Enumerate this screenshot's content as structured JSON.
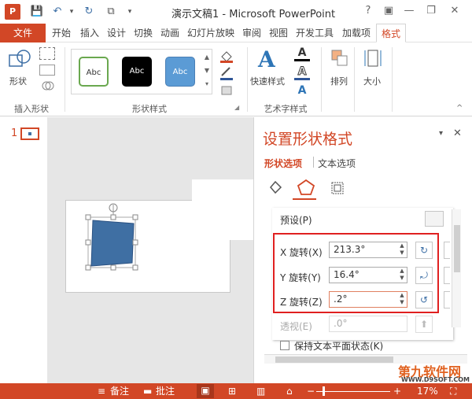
{
  "title": "演示文稿1 - Microsoft PowerPoint",
  "app_icon_letter": "P",
  "qat": {
    "save": "💾",
    "undo": "↶",
    "redo": "↻",
    "preview": "⧉",
    "more": "▾"
  },
  "window_buttons": {
    "help": "?",
    "ribbon": "▣",
    "minimize": "—",
    "restore": "❐",
    "close": "✕"
  },
  "tabs": [
    "文件",
    "开始",
    "插入",
    "设计",
    "切换",
    "动画",
    "幻灯片放映",
    "审阅",
    "视图",
    "开发工具",
    "加载项",
    "格式"
  ],
  "ribbon": {
    "insert_shapes": {
      "label": "插入形状",
      "shape_button": "形状"
    },
    "shape_styles": {
      "label": "形状样式",
      "thumbs": [
        "Abc",
        "Abc",
        "Abc"
      ]
    },
    "wordart": {
      "label": "艺术字样式",
      "quick_styles": "快速样式",
      "letter": "A"
    },
    "arrange": "排列",
    "size": "大小"
  },
  "slide_number": "1",
  "format_pane": {
    "title": "设置形状格式",
    "tab_shape_options": "形状选项",
    "tab_text_options": "文本选项",
    "preset_label": "预设(P)",
    "x_rotation": {
      "label": "X 旋转(X)",
      "value": "213.3°"
    },
    "y_rotation": {
      "label": "Y 旋转(Y)",
      "value": "16.4°"
    },
    "z_rotation": {
      "label": "Z 旋转(Z)",
      "value": ".2°"
    },
    "perspective": {
      "label": "透视(E)",
      "value": ".0°"
    },
    "keep_text_flat": "保持文本平面状态(K)",
    "pin_icon": "▾",
    "close_icon": "✕"
  },
  "status": {
    "notes": "备注",
    "comments": "批注",
    "zoom": "17%",
    "zoom_minus": "−",
    "zoom_plus": "+"
  },
  "watermark": {
    "brand": "第九软件网",
    "url": "WWW.D9SOFT.COM"
  },
  "colors": {
    "accent": "#d24726",
    "shape_fill": "#3f6fa3",
    "highlight_box": "#e02020"
  }
}
